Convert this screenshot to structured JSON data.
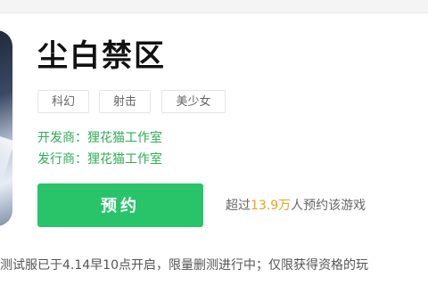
{
  "game": {
    "title": "尘白禁区",
    "tags": [
      "科幻",
      "射击",
      "美少女"
    ],
    "developer_label": "开发商：",
    "developer": "狸花猫工作室",
    "publisher_label": "发行商：",
    "publisher": "狸花猫工作室"
  },
  "reserve": {
    "button_label": "预约",
    "count_prefix": "超过",
    "count_value": "13.9万",
    "count_suffix": "人预约该游戏"
  },
  "notice": "测试服已于4.14早10点开启，限量删测进行中；仅限获得资格的玩",
  "colors": {
    "accent_green": "#29c46a",
    "info_green": "#2fae55",
    "highlight_orange": "#f0a019"
  }
}
